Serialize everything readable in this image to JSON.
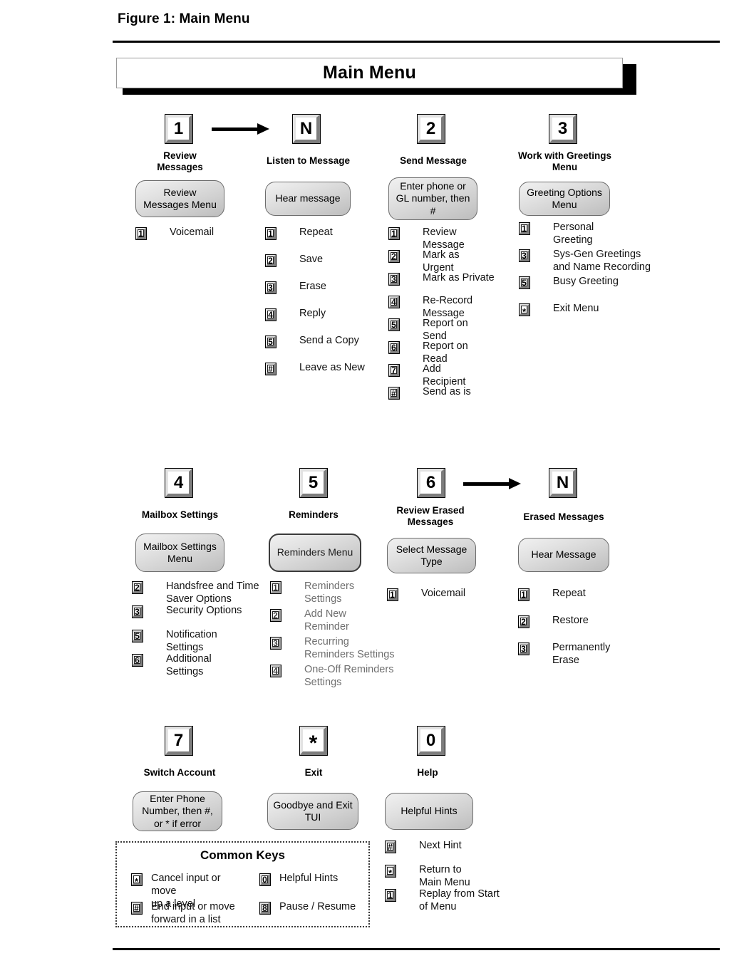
{
  "figure": {
    "caption": "Figure 1: Main Menu",
    "title_bar": "Main Menu"
  },
  "colors": {
    "ink": "#000000",
    "key_face": "#ffffff",
    "key_light_bevel": "#e2e2e2",
    "key_dark_bevel": "#7d7d7d",
    "capsule_top": "#f1f1f1",
    "capsule_bottom": "#bdbdbd",
    "faded_text": "#6f6f6f"
  },
  "columns": [
    {
      "id": "review-messages",
      "key": "1",
      "title": "Review\nMessages",
      "capsule": "Review\nMessages Menu",
      "options": [
        {
          "key": "1",
          "label": "Voicemail"
        }
      ]
    },
    {
      "id": "listen-to-message",
      "key": "N",
      "title": "Listen to Message",
      "capsule": "Hear message",
      "options": [
        {
          "key": "1",
          "label": "Repeat"
        },
        {
          "key": "2",
          "label": "Save"
        },
        {
          "key": "3",
          "label": "Erase"
        },
        {
          "key": "4",
          "label": "Reply"
        },
        {
          "key": "5",
          "label": "Send a Copy"
        },
        {
          "key": "#",
          "label": "Leave as New"
        }
      ]
    },
    {
      "id": "send-message",
      "key": "2",
      "title": "Send Message",
      "capsule": "Enter phone or\nGL number, then\n#",
      "options": [
        {
          "key": "1",
          "label": "Review\nMessage"
        },
        {
          "key": "2",
          "label": "Mark as\nUrgent"
        },
        {
          "key": "3",
          "label": "Mark as Private"
        },
        {
          "key": "4",
          "label": "Re-Record\nMessage"
        },
        {
          "key": "5",
          "label": "Report on\nSend"
        },
        {
          "key": "6",
          "label": "Report on\nRead"
        },
        {
          "key": "7",
          "label": "Add\nRecipient"
        },
        {
          "key": "#",
          "label": "Send as is"
        }
      ]
    },
    {
      "id": "work-with-greetings",
      "key": "3",
      "title": "Work with Greetings\nMenu",
      "capsule": "Greeting Options\nMenu",
      "options": [
        {
          "key": "1",
          "label": "Personal\nGreeting"
        },
        {
          "key": "3",
          "label": "Sys-Gen Greetings\nand Name Recording"
        },
        {
          "key": "5",
          "label": "Busy Greeting"
        },
        {
          "key": "*",
          "label": "Exit Menu"
        }
      ]
    },
    {
      "id": "mailbox-settings",
      "key": "4",
      "title": "Mailbox Settings",
      "capsule": "Mailbox Settings\nMenu",
      "options": [
        {
          "key": "2",
          "label": "Handsfree and Time\nSaver Options"
        },
        {
          "key": "3",
          "label": "Security Options"
        },
        {
          "key": "5",
          "label": "Notification\nSettings"
        },
        {
          "key": "6",
          "label": "Additional\nSettings"
        }
      ]
    },
    {
      "id": "reminders",
      "key": "5",
      "title": "Reminders",
      "capsule": "Reminders Menu",
      "options": [
        {
          "key": "1",
          "label": "Reminders\nSettings"
        },
        {
          "key": "2",
          "label": "Add New\nReminder"
        },
        {
          "key": "3",
          "label": "Recurring\nReminders Settings"
        },
        {
          "key": "4",
          "label": "One-Off Reminders\nSettings"
        }
      ]
    },
    {
      "id": "review-erased-messages",
      "key": "6",
      "title": "Review Erased\nMessages",
      "capsule": "Select Message\nType",
      "options": [
        {
          "key": "1",
          "label": "Voicemail"
        }
      ]
    },
    {
      "id": "erased-messages",
      "key": "N",
      "title": "Erased Messages",
      "capsule": "Hear Message",
      "options": [
        {
          "key": "1",
          "label": "Repeat"
        },
        {
          "key": "2",
          "label": "Restore"
        },
        {
          "key": "3",
          "label": "Permanently\nErase"
        }
      ]
    },
    {
      "id": "switch-account",
      "key": "7",
      "title": "Switch Account",
      "capsule": "Enter Phone\nNumber, then #,\nor * if error",
      "options": []
    },
    {
      "id": "exit",
      "key": "*",
      "title": "Exit",
      "capsule": "Goodbye and Exit\nTUI",
      "options": []
    },
    {
      "id": "help",
      "key": "0",
      "title": "Help",
      "capsule": "Helpful Hints",
      "options": [
        {
          "key": "#",
          "label": "Next Hint"
        },
        {
          "key": "*",
          "label": "Return to\nMain Menu"
        },
        {
          "key": "1",
          "label": "Replay from Start\nof Menu"
        }
      ]
    }
  ],
  "common_keys": {
    "title": "Common Keys",
    "items": [
      {
        "key": "*",
        "label": "Cancel input or move\nup a level"
      },
      {
        "key": "0",
        "label": "Helpful Hints"
      },
      {
        "key": "#",
        "label": "End input or move\nforward in a list"
      },
      {
        "key": "8",
        "label": "Pause / Resume"
      }
    ]
  },
  "arrows": [
    {
      "id": "arrow-review-to-listen"
    },
    {
      "id": "arrow-erased-to-hear"
    }
  ]
}
